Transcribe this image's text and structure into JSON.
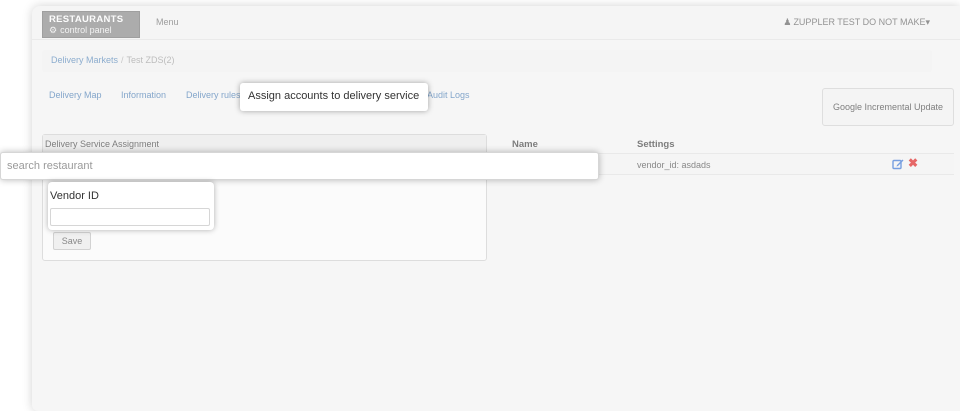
{
  "navbar": {
    "brand_top": "RESTAURANTS",
    "brand_bottom": "control panel",
    "menu_label": "Menu",
    "user_label": "ZUPPLER TEST DO NOT MAKE",
    "caret": "▾"
  },
  "breadcrumb": {
    "parent": "Delivery Markets",
    "separator": "/",
    "current": "Test ZDS(2)"
  },
  "tabs": {
    "delivery_map": "Delivery Map",
    "information": "Information",
    "delivery_rules": "Delivery rules",
    "audit_logs": "Audit Logs"
  },
  "tooltip": {
    "assign_accounts": "Assign accounts to delivery service"
  },
  "buttons": {
    "google_update": "Google Incremental Update",
    "save": "Save"
  },
  "panel": {
    "heading": "Delivery Service Assignment"
  },
  "search": {
    "placeholder": "search restaurant"
  },
  "vendor": {
    "label": "Vendor ID",
    "value": ""
  },
  "table": {
    "columns": [
      "Name",
      "Settings"
    ],
    "rows": [
      {
        "name": "",
        "settings": "vendor_id: asdads"
      }
    ]
  },
  "colors": {
    "link": "#3d74b0",
    "delete": "#dd1111",
    "edit": "#2a6ad4"
  },
  "icons": [
    "gear-icon",
    "user-icon",
    "edit-icon",
    "delete-icon"
  ]
}
